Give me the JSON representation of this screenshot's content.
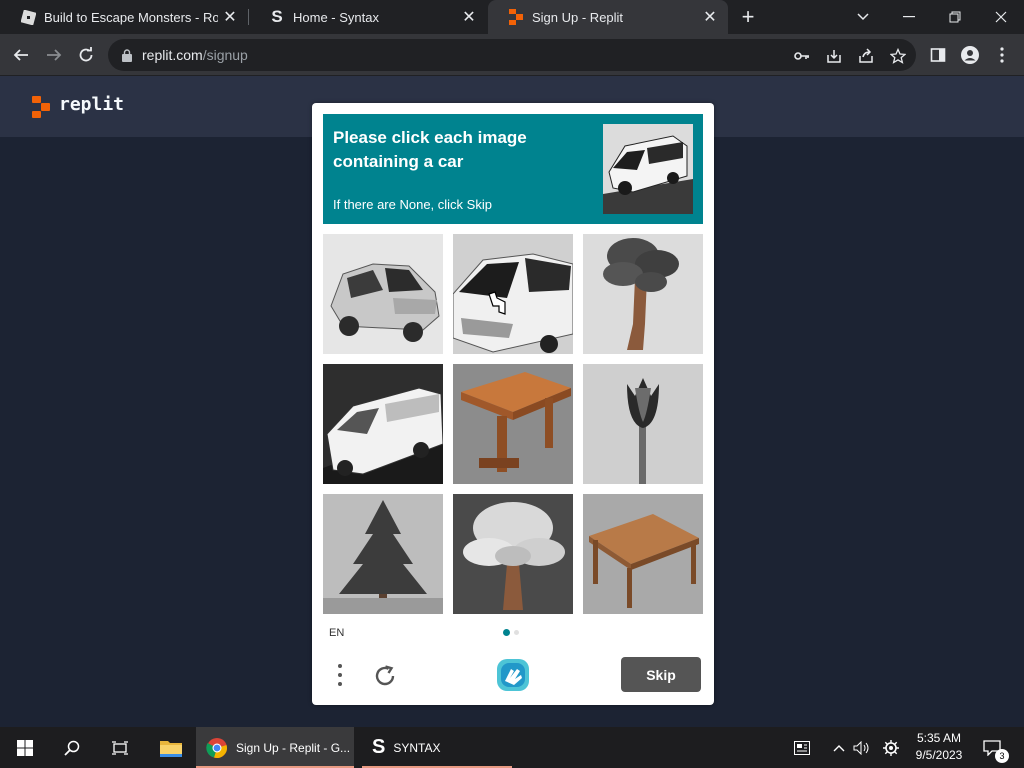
{
  "browser": {
    "tabs": [
      {
        "title": "Build to Escape Monsters - Roblo",
        "icon": "roblox-icon",
        "active": false
      },
      {
        "title": "Home - Syntax",
        "icon": "syntax-s-icon",
        "active": false
      },
      {
        "title": "Sign Up - Replit",
        "icon": "replit-icon",
        "active": true
      }
    ],
    "new_tab_label": "+",
    "url_host": "replit.com",
    "url_path": "/signup"
  },
  "site": {
    "brand": "replit",
    "brand_color": "#f26207"
  },
  "captcha": {
    "prompt_line1": "Please click each image",
    "prompt_line2": "containing a car",
    "hint": "If there are None, click Skip",
    "prompt_bg": "#00838f",
    "tiles": [
      {
        "subject": "car"
      },
      {
        "subject": "car"
      },
      {
        "subject": "tree"
      },
      {
        "subject": "van"
      },
      {
        "subject": "table"
      },
      {
        "subject": "tulip"
      },
      {
        "subject": "tree"
      },
      {
        "subject": "tree"
      },
      {
        "subject": "table"
      }
    ],
    "language": "EN",
    "skip_label": "Skip"
  },
  "taskbar": {
    "apps": [
      {
        "label": "Sign Up - Replit - G...",
        "icon": "chrome-icon",
        "active": true
      },
      {
        "label": "SYNTAX",
        "icon": "syntax-s-icon",
        "active": false
      }
    ],
    "time": "5:35 AM",
    "date": "9/5/2023",
    "notification_count": "3"
  }
}
